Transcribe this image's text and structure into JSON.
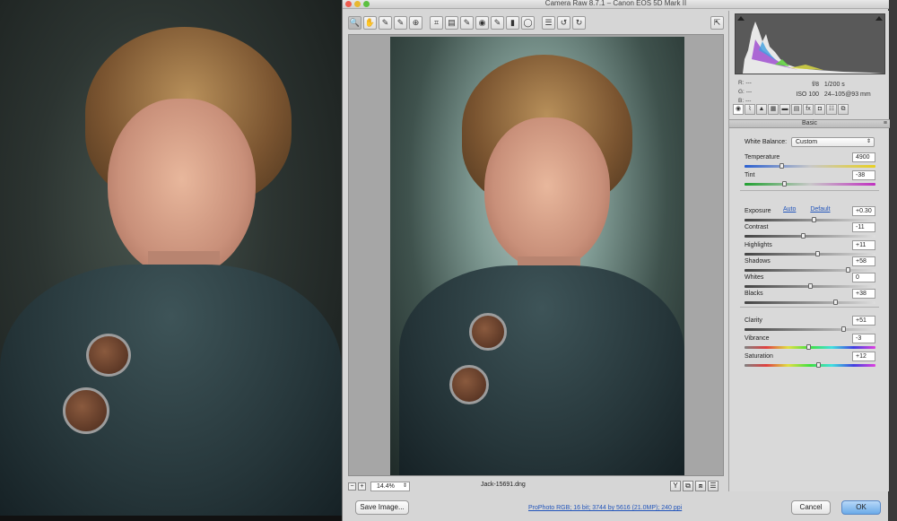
{
  "window": {
    "title": "Camera Raw 8.7.1  –  Canon EOS 5D Mark II"
  },
  "toolbar": {
    "tools": [
      {
        "name": "zoom-tool-button",
        "glyph": "🔍"
      },
      {
        "name": "hand-tool-button",
        "glyph": "✋"
      },
      {
        "name": "white-balance-tool-button",
        "glyph": "✎"
      },
      {
        "name": "color-sampler-tool-button",
        "glyph": "✎"
      },
      {
        "name": "targeted-adjustment-tool-button",
        "glyph": "⊕"
      },
      {
        "name": "crop-tool-button",
        "glyph": "⌗"
      },
      {
        "name": "straighten-tool-button",
        "glyph": "▤"
      },
      {
        "name": "spot-removal-tool-button",
        "glyph": "✎"
      },
      {
        "name": "red-eye-tool-button",
        "glyph": "◉"
      },
      {
        "name": "adjustment-brush-button",
        "glyph": "✎"
      },
      {
        "name": "graduated-filter-button",
        "glyph": "▮"
      },
      {
        "name": "radial-filter-button",
        "glyph": "◯"
      },
      {
        "name": "preferences-button",
        "glyph": "☰"
      },
      {
        "name": "rotate-ccw-button",
        "glyph": "↺"
      },
      {
        "name": "rotate-cw-button",
        "glyph": "↻"
      }
    ],
    "fullscreen_glyph": "⇱"
  },
  "preview": {
    "zoom_value": "14.4%",
    "filename": "Jack-15691.dng",
    "view_buttons": [
      "Y",
      "⧉",
      "⧈",
      "☰"
    ]
  },
  "histogram": {
    "rgb": [
      {
        "label": "R:",
        "value": "---"
      },
      {
        "label": "G:",
        "value": "---"
      },
      {
        "label": "B:",
        "value": "---"
      }
    ],
    "aperture": "f/8",
    "shutter": "1/200 s",
    "iso": "ISO 100",
    "lens": "24–105@93 mm"
  },
  "panel": {
    "tabs": [
      "◉",
      "⌇",
      "▲",
      "▦",
      "▬",
      "▤",
      "fx",
      "◘",
      "☷",
      "⧉"
    ],
    "header": "Basic",
    "white_balance_label": "White Balance:",
    "white_balance_value": "Custom",
    "auto_link": "Auto",
    "default_link": "Default",
    "sliders": [
      {
        "label": "Temperature",
        "value": "4900",
        "position": 0.28,
        "track": "temp"
      },
      {
        "label": "Tint",
        "value": "-38",
        "position": 0.3,
        "track": "tint"
      },
      {
        "label": "Exposure",
        "value": "+0.30",
        "position": 0.53,
        "track": ""
      },
      {
        "label": "Contrast",
        "value": "-11",
        "position": 0.445,
        "track": ""
      },
      {
        "label": "Highlights",
        "value": "+11",
        "position": 0.555,
        "track": ""
      },
      {
        "label": "Shadows",
        "value": "+58",
        "position": 0.79,
        "track": ""
      },
      {
        "label": "Whites",
        "value": "0",
        "position": 0.5,
        "track": ""
      },
      {
        "label": "Blacks",
        "value": "+38",
        "position": 0.69,
        "track": ""
      },
      {
        "label": "Clarity",
        "value": "+51",
        "position": 0.755,
        "track": ""
      },
      {
        "label": "Vibrance",
        "value": "-3",
        "position": 0.485,
        "track": "vib"
      },
      {
        "label": "Saturation",
        "value": "+12",
        "position": 0.56,
        "track": "sat"
      }
    ]
  },
  "footer": {
    "save_label": "Save Image...",
    "workflow_link": "ProPhoto RGB; 16 bit; 3744 by 5616 (21.0MP); 240 ppi",
    "cancel_label": "Cancel",
    "ok_label": "OK"
  },
  "colors": {
    "accent": "#6aaae8",
    "link": "#2255bb"
  }
}
